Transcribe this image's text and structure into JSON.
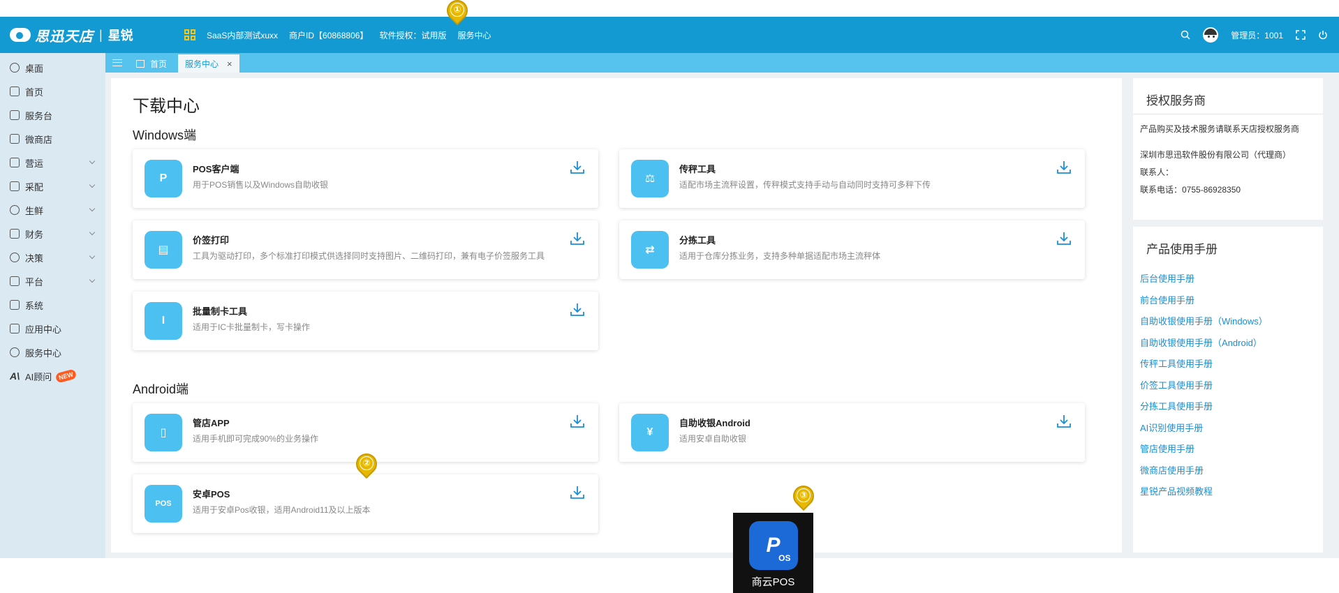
{
  "header": {
    "brand": "思迅天店",
    "product": "星锐",
    "company": "SaaS内部测试xuxx",
    "merchant": "商户ID【60868806】",
    "license": "软件授权：试用版",
    "service": "服务中心",
    "admin": "管理员：1001"
  },
  "markers": [
    "①",
    "②",
    "③"
  ],
  "sidebar": {
    "items": [
      {
        "label": "桌面",
        "arrow": false
      },
      {
        "label": "首页",
        "arrow": false
      },
      {
        "label": "服务台",
        "arrow": false
      },
      {
        "label": "微商店",
        "arrow": false
      },
      {
        "label": "营运",
        "arrow": true
      },
      {
        "label": "采配",
        "arrow": true
      },
      {
        "label": "生鲜",
        "arrow": true
      },
      {
        "label": "财务",
        "arrow": true
      },
      {
        "label": "决策",
        "arrow": true
      },
      {
        "label": "平台",
        "arrow": true
      },
      {
        "label": "系统",
        "arrow": false
      },
      {
        "label": "应用中心",
        "arrow": false
      },
      {
        "label": "服务中心",
        "arrow": false
      }
    ],
    "ai": {
      "label": "AI顾问",
      "badge": "NEW"
    }
  },
  "tabs": {
    "home": "首页",
    "active": "服务中心",
    "close": "×"
  },
  "main": {
    "title": "下载中心",
    "windows_title": "Windows端",
    "android_title": "Android端",
    "windows_cards": [
      {
        "title": "POS客户端",
        "desc": "用于POS销售以及Windows自助收银",
        "icon": "P"
      },
      {
        "title": "传秤工具",
        "desc": "适配市场主流秤设置，传秤模式支持手动与自动同时支持可多秤下传",
        "icon": "⚖"
      },
      {
        "title": "价签打印",
        "desc": "工具为驱动打印，多个标准打印模式供选择同时支持图片、二维码打印，兼有电子价签服务工具",
        "icon": "▤"
      },
      {
        "title": "分拣工具",
        "desc": "适用于仓库分拣业务，支持多种单据适配市场主流秤体",
        "icon": "⇄"
      },
      {
        "title": "批量制卡工具",
        "desc": "适用于IC卡批量制卡，写卡操作",
        "icon": "I"
      }
    ],
    "android_cards": [
      {
        "title": "管店APP",
        "desc": "适用手机即可完成90%的业务操作",
        "icon": "▯"
      },
      {
        "title": "自助收银Android",
        "desc": "适用安卓自助收银",
        "icon": "¥"
      },
      {
        "title": "安卓POS",
        "desc": "适用于安卓Pos收银，适用Android11及以上版本",
        "icon": "POS"
      }
    ]
  },
  "right": {
    "auth_title": "授权服务商",
    "auth_intro": "产品购买及技术服务请联系天店授权服务商",
    "auth_company": "深圳市思迅软件股份有限公司（代理商）",
    "auth_contact": "联系人：",
    "auth_phone": "联系电话：0755-86928350",
    "manual_title": "产品使用手册",
    "manuals": [
      "后台使用手册",
      "前台使用手册",
      "自助收银使用手册（Windows）",
      "自助收银使用手册（Android）",
      "传秤工具使用手册",
      "价签工具使用手册",
      "分拣工具使用手册",
      "AI识别使用手册",
      "管店使用手册",
      "微商店使用手册",
      "星锐产品视频教程"
    ]
  },
  "desktop_icon": {
    "label": "商云POS",
    "glyph": "P"
  },
  "colors": {
    "header": "#139ad3",
    "tabbar": "#55c3ee",
    "sidebar": "#dbe9f3",
    "card_icon": "#4cc0f0",
    "link": "#1a8fd6",
    "marker": "#e6b800"
  }
}
